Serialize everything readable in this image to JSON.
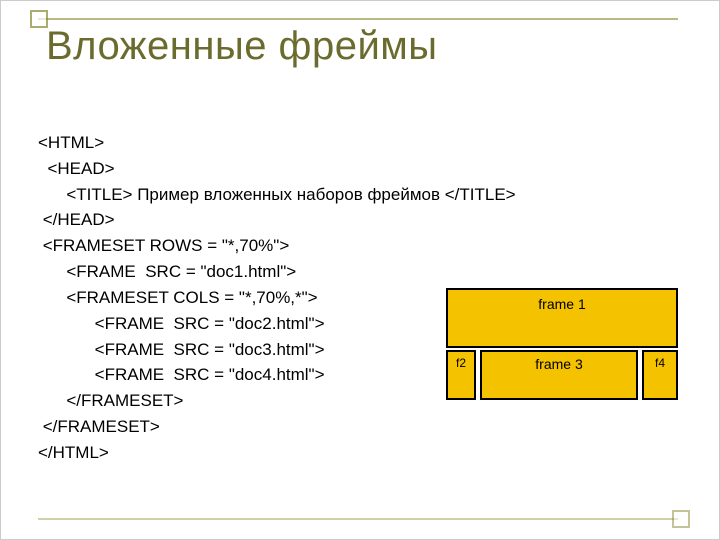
{
  "title": "Вложенные фреймы",
  "code": {
    "l1": "<HTML>",
    "l2": "  <HEAD>",
    "l3": "      <TITLE> Пример вложенных наборов фреймов </TITLE>",
    "l4": " </HEAD>",
    "l5": " <FRAMESET ROWS = \"*,70%\">",
    "l6": "      <FRAME  SRC = \"doc1.html\">",
    "l7": "      <FRAMESET COLS = \"*,70%,*\">",
    "l8": "            <FRAME  SRC = \"doc2.html\">",
    "l9": "            <FRAME  SRC = \"doc3.html\">",
    "l10": "            <FRAME  SRC = \"doc4.html\">",
    "l11": "      </FRAMESET>",
    "l12": " </FRAMESET>",
    "l13": "</HTML>"
  },
  "diagram": {
    "frame1": "frame 1",
    "frame2": "f2",
    "frame3": "frame 3",
    "frame4": "f4"
  }
}
